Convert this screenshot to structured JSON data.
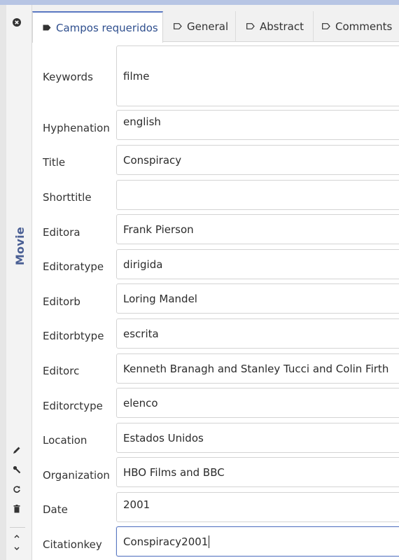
{
  "sidebar": {
    "title": "Movie",
    "icons": {
      "close": "close-icon",
      "edit": "pencil-icon",
      "wrench": "wrench-icon",
      "refresh": "refresh-icon",
      "delete": "trash-icon",
      "up": "chevron-up-icon",
      "down": "chevron-down-icon"
    }
  },
  "tabs": [
    {
      "label": "Campos requeridos",
      "active": true
    },
    {
      "label": "General",
      "active": false
    },
    {
      "label": "Abstract",
      "active": false
    },
    {
      "label": "Comments",
      "active": false
    }
  ],
  "fields": [
    {
      "label": "Keywords",
      "value": "filme"
    },
    {
      "label": "Hyphenation",
      "value": "english"
    },
    {
      "label": "Title",
      "value": "Conspiracy"
    },
    {
      "label": "Shorttitle",
      "value": ""
    },
    {
      "label": "Editora",
      "value": "Frank Pierson"
    },
    {
      "label": "Editoratype",
      "value": "dirigida"
    },
    {
      "label": "Editorb",
      "value": "Loring Mandel"
    },
    {
      "label": "Editorbtype",
      "value": "escrita"
    },
    {
      "label": "Editorc",
      "value": "Kenneth Branagh and Stanley Tucci and Colin Firth"
    },
    {
      "label": "Editorctype",
      "value": "elenco"
    },
    {
      "label": "Location",
      "value": "Estados Unidos"
    },
    {
      "label": "Organization",
      "value": "HBO Films and BBC"
    },
    {
      "label": "Date",
      "value": "2001"
    },
    {
      "label": "Citationkey",
      "value": "Conspiracy2001"
    }
  ],
  "colors": {
    "accent": "#5a77c2",
    "title": "#4a5f94",
    "topbar": "#b7c5e4"
  }
}
